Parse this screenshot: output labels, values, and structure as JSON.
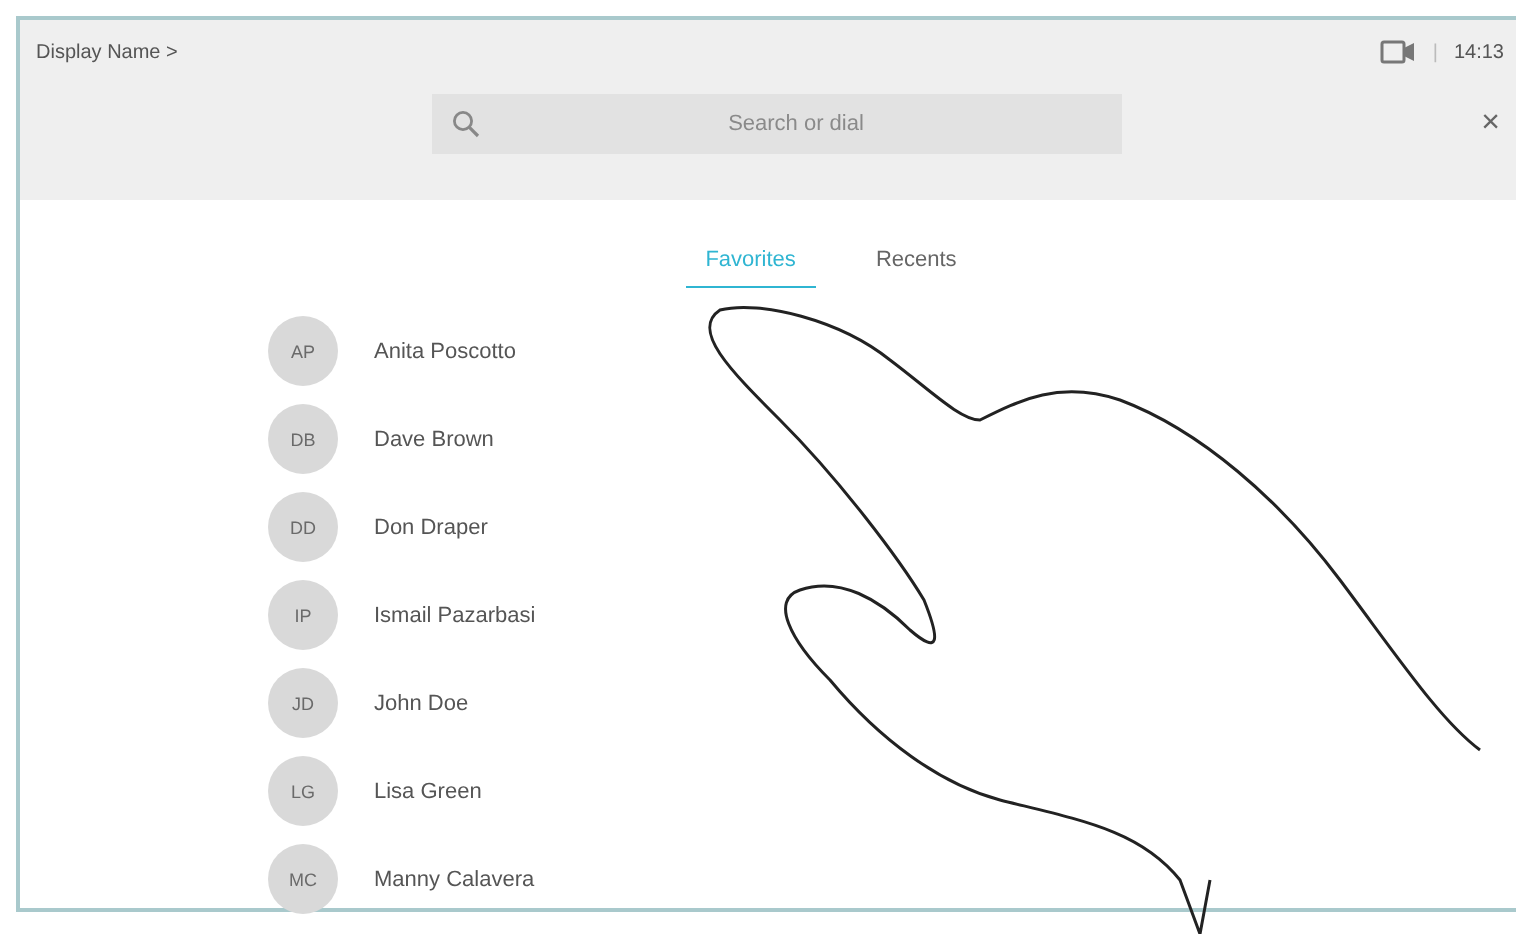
{
  "header": {
    "display_name": "Display Name >",
    "separator": "|",
    "time": "14:13"
  },
  "search": {
    "placeholder": "Search or dial"
  },
  "close": "×",
  "tabs": [
    {
      "label": "Favorites",
      "selected": true
    },
    {
      "label": "Recents",
      "selected": false
    }
  ],
  "contacts": [
    {
      "initials": "AP",
      "name": "Anita Poscotto"
    },
    {
      "initials": "DB",
      "name": "Dave Brown"
    },
    {
      "initials": "DD",
      "name": "Don Draper"
    },
    {
      "initials": "IP",
      "name": "Ismail Pazarbasi"
    },
    {
      "initials": "JD",
      "name": "John Doe"
    },
    {
      "initials": "LG",
      "name": "Lisa Green"
    },
    {
      "initials": "MC",
      "name": "Manny Calavera"
    }
  ]
}
